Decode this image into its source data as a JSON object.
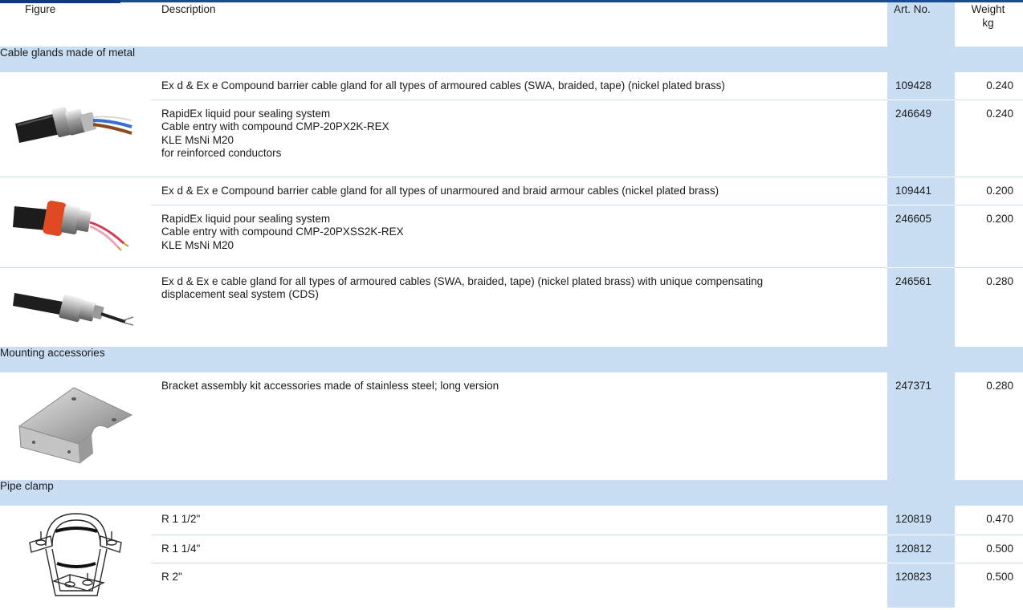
{
  "header": {
    "figure": "Figure",
    "description": "Description",
    "art_no": "Art. No.",
    "weight_line1": "Weight",
    "weight_line2": "kg"
  },
  "sections": [
    {
      "title": "Cable glands made of metal",
      "products": [
        {
          "image": "armoured-cable-gland-image",
          "items": [
            {
              "lines": [
                "Ex d & Ex e Compound barrier cable gland for all types of armoured cables (SWA, braided, tape) (nickel plated brass)"
              ],
              "art_no": "109428",
              "weight": "0.240"
            },
            {
              "lines": [
                "RapidEx liquid pour sealing system",
                "Cable entry with compound CMP-20PX2K-REX",
                "KLE MsNi M20",
                "for reinforced conductors"
              ],
              "art_no": "246649",
              "weight": "0.240"
            }
          ]
        },
        {
          "image": "unarmoured-cable-gland-image",
          "items": [
            {
              "lines": [
                "Ex d & Ex e Compound barrier cable gland for all types of unarmoured and braid armour cables (nickel plated brass)"
              ],
              "art_no": "109441",
              "weight": "0.200"
            },
            {
              "lines": [
                "RapidEx liquid pour sealing system",
                "Cable entry with compound CMP-20PXSS2K-REX",
                "KLE MsNi M20"
              ],
              "art_no": "246605",
              "weight": "0.200"
            }
          ]
        },
        {
          "image": "cds-cable-gland-image",
          "items": [
            {
              "lines": [
                "Ex d & Ex e cable gland for all types of armoured cables (SWA, braided, tape) (nickel plated brass) with unique compensating",
                "displacement seal system (CDS)"
              ],
              "art_no": "246561",
              "weight": "0.280"
            }
          ]
        }
      ]
    },
    {
      "title": "Mounting accessories",
      "products": [
        {
          "image": "bracket-assembly-image",
          "items": [
            {
              "lines": [
                "Bracket assembly kit accessories made of stainless steel; long version"
              ],
              "art_no": "247371",
              "weight": "0.280"
            }
          ]
        }
      ]
    },
    {
      "title": "Pipe clamp",
      "products": [
        {
          "image": "pipe-clamp-image",
          "items": [
            {
              "lines": [
                "R 1 1/2\""
              ],
              "art_no": "120819",
              "weight": "0.470"
            },
            {
              "lines": [
                "R 1 1/4\""
              ],
              "art_no": "120812",
              "weight": "0.500"
            },
            {
              "lines": [
                "R 2\""
              ],
              "art_no": "120823",
              "weight": "0.500"
            }
          ]
        }
      ]
    }
  ],
  "colors": {
    "accent_bar": "#1a4a8f",
    "highlight": "#c9def3",
    "text": "#1a1a1a"
  }
}
